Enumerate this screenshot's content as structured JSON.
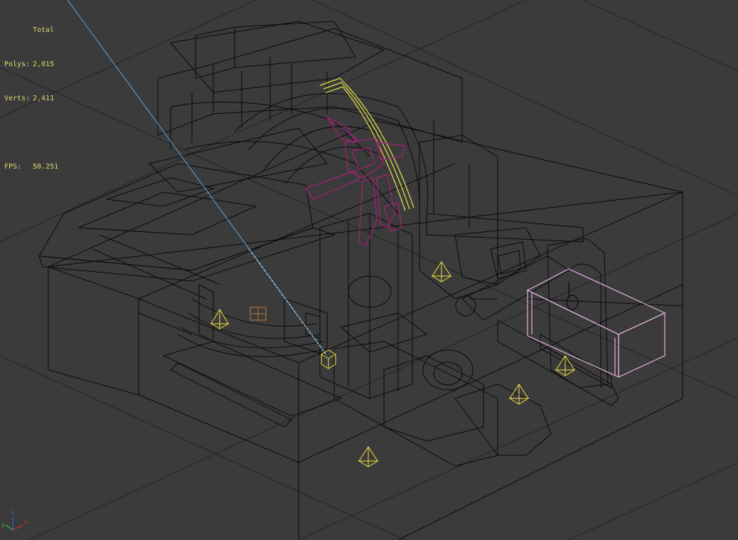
{
  "stats": {
    "header": "Total",
    "polys_label": "Polys:",
    "polys_value": "2,015",
    "verts_label": "Verts:",
    "verts_value": "2,411",
    "fps_label": "FPS:",
    "fps_value": "50.251"
  },
  "axis_gizmo": {
    "x": "x",
    "y": "y",
    "z": "z"
  },
  "colors": {
    "background": "#3b3b3b",
    "grid": "#262626",
    "wire": "#0a0a0a",
    "stats_text": "#e0d870",
    "helper": "#f0e040",
    "selection_box": "#e8b0e0",
    "bone": "#a8207a",
    "spline": "#c8c848",
    "ray": "#5aa8e0",
    "axis_x": "#e03030",
    "axis_y": "#30c030",
    "axis_z": "#3060e0"
  }
}
